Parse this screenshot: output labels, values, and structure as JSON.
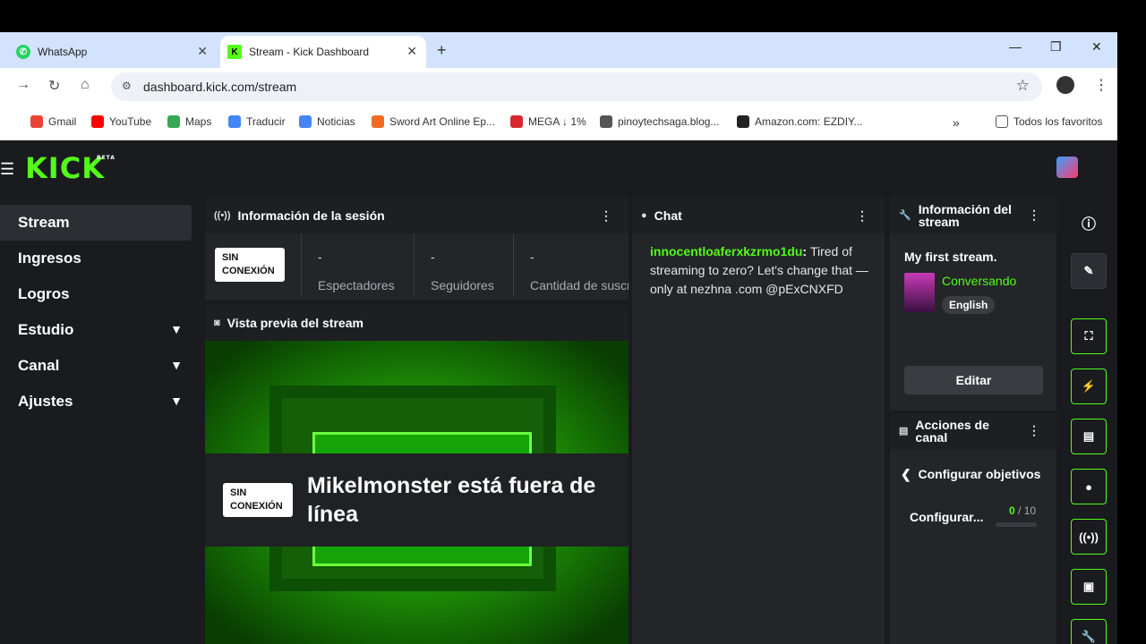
{
  "browser": {
    "tabs": [
      {
        "title": "WhatsApp",
        "icon": "whatsapp-icon"
      },
      {
        "title": "Stream - Kick Dashboard",
        "icon": "kick-icon"
      }
    ],
    "url": "dashboard.kick.com/stream",
    "bookmarks": [
      {
        "label": "Gmail",
        "color": "#ea4335"
      },
      {
        "label": "YouTube",
        "color": "#ff0000"
      },
      {
        "label": "Maps",
        "color": "#34a853"
      },
      {
        "label": "Traducir",
        "color": "#4285f4"
      },
      {
        "label": "Noticias",
        "color": "#4285f4"
      },
      {
        "label": "Sword Art Online Ep...",
        "color": "#f36a21"
      },
      {
        "label": "MEGA ↓ 1%",
        "color": "#d9272e"
      },
      {
        "label": "pinoytechsaga.blog...",
        "color": "#555555"
      },
      {
        "label": "Amazon.com: EZDIY...",
        "color": "#222222"
      }
    ],
    "bookmarks_overflow": "»",
    "all_bookmarks": "Todos los favoritos"
  },
  "app": {
    "logo": "KICK",
    "beta": "BETA",
    "accent": "#53fc18"
  },
  "sidebar": {
    "items": [
      {
        "label": "Stream",
        "active": true
      },
      {
        "label": "Ingresos"
      },
      {
        "label": "Logros"
      },
      {
        "label": "Estudio",
        "expandable": true
      },
      {
        "label": "Canal",
        "expandable": true
      },
      {
        "label": "Ajustes",
        "expandable": true
      }
    ]
  },
  "session": {
    "title": "Información de la sesión",
    "status": "SIN CONEXIÓN",
    "stats": [
      {
        "value": "-",
        "label": "Espectadores"
      },
      {
        "value": "-",
        "label": "Seguidores"
      },
      {
        "value": "-",
        "label": "Cantidad de suscripciones"
      }
    ]
  },
  "preview": {
    "title": "Vista previa del stream",
    "status": "SIN CONEXIÓN",
    "message": "Mikelmonster está fuera de línea"
  },
  "chat": {
    "title": "Chat",
    "messages": [
      {
        "user": "innocentloaferxkzrmo1du",
        "text": "Tired of streaming to zero? Let's change that — only at nezhna .com @pExCNXFD"
      }
    ]
  },
  "stream_info": {
    "title": "Información del stream",
    "stream_title": "My first stream.",
    "category": "Conversando",
    "language": "English",
    "edit_label": "Editar"
  },
  "channel_actions": {
    "title": "Acciones de canal",
    "back_label": "Configurar objetivos",
    "row_label": "Configurar...",
    "current": "0",
    "total": "/ 10",
    "progress": 0
  },
  "rail": {
    "icons": [
      "info-icon",
      "edit-icon",
      "scan-icon",
      "bolt-icon",
      "note-icon",
      "chat-icon",
      "broadcast-icon",
      "layout-icon",
      "wrench-icon"
    ]
  }
}
